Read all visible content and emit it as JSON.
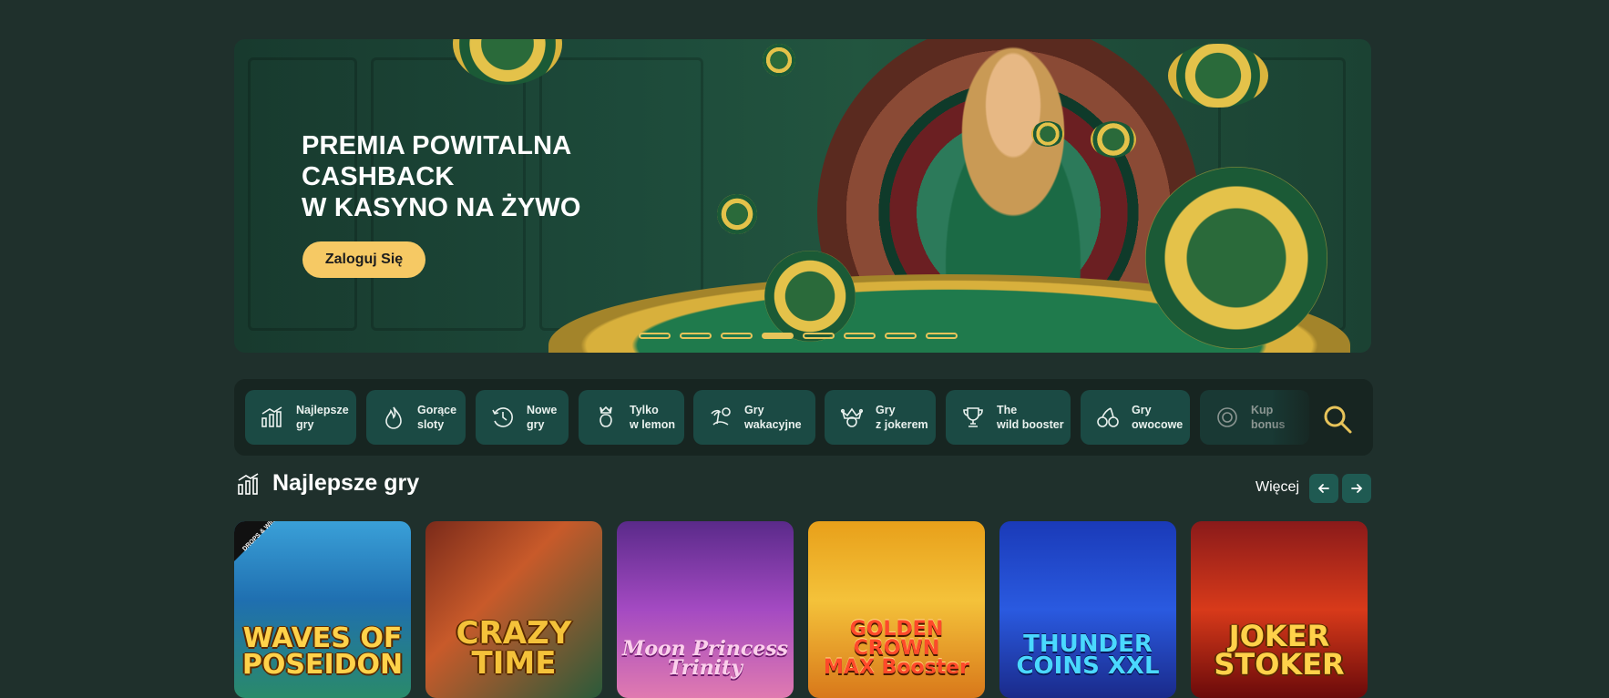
{
  "hero": {
    "headline_line1": "PREMIA POWITALNA",
    "headline_line2": "CASHBACK",
    "headline_line3": "W KASYNO NA ŻYWO",
    "login_label": "Zaloguj Się",
    "slides_total": 8,
    "active_slide": 4
  },
  "categories": [
    {
      "line1": "Najlepsze",
      "line2": "gry",
      "icon": "chart-icon"
    },
    {
      "line1": "Gorące",
      "line2": "sloty",
      "icon": "flame-icon"
    },
    {
      "line1": "Nowe",
      "line2": "gry",
      "icon": "clock-icon"
    },
    {
      "line1": "Tylko",
      "line2": "w lemon",
      "icon": "lemon-crown-icon"
    },
    {
      "line1": "Gry",
      "line2": "wakacyjne",
      "icon": "beach-icon"
    },
    {
      "line1": "Gry",
      "line2": "z jokerem",
      "icon": "joker-icon"
    },
    {
      "line1": "The",
      "line2": "wild booster",
      "icon": "trophy-icon"
    },
    {
      "line1": "Gry",
      "line2": "owocowe",
      "icon": "cherry-icon"
    },
    {
      "line1": "Kup",
      "line2": "bonus",
      "icon": "coin-icon"
    }
  ],
  "section": {
    "title": "Najlepsze gry",
    "more_label": "Więcej"
  },
  "games": [
    {
      "name_line1": "WAVES OF",
      "name_line2": "POSEIDON",
      "badge": "DROPS & WINS"
    },
    {
      "name_line1": "CRAZY",
      "name_line2": "TIME",
      "badge": ""
    },
    {
      "name_line1": "Moon Princess",
      "name_line2": "Trinity",
      "badge": ""
    },
    {
      "name_line1": "GOLDEN CROWN",
      "name_line2": "MAX Booster",
      "badge": ""
    },
    {
      "name_line1": "THUNDER",
      "name_line2": "COINS XXL",
      "badge": ""
    },
    {
      "name_line1": "JOKER",
      "name_line2": "STOKER",
      "badge": ""
    }
  ],
  "colors": {
    "background": "#1f302c",
    "accent_yellow": "#f6c964",
    "category_bg": "#1b4a44"
  }
}
